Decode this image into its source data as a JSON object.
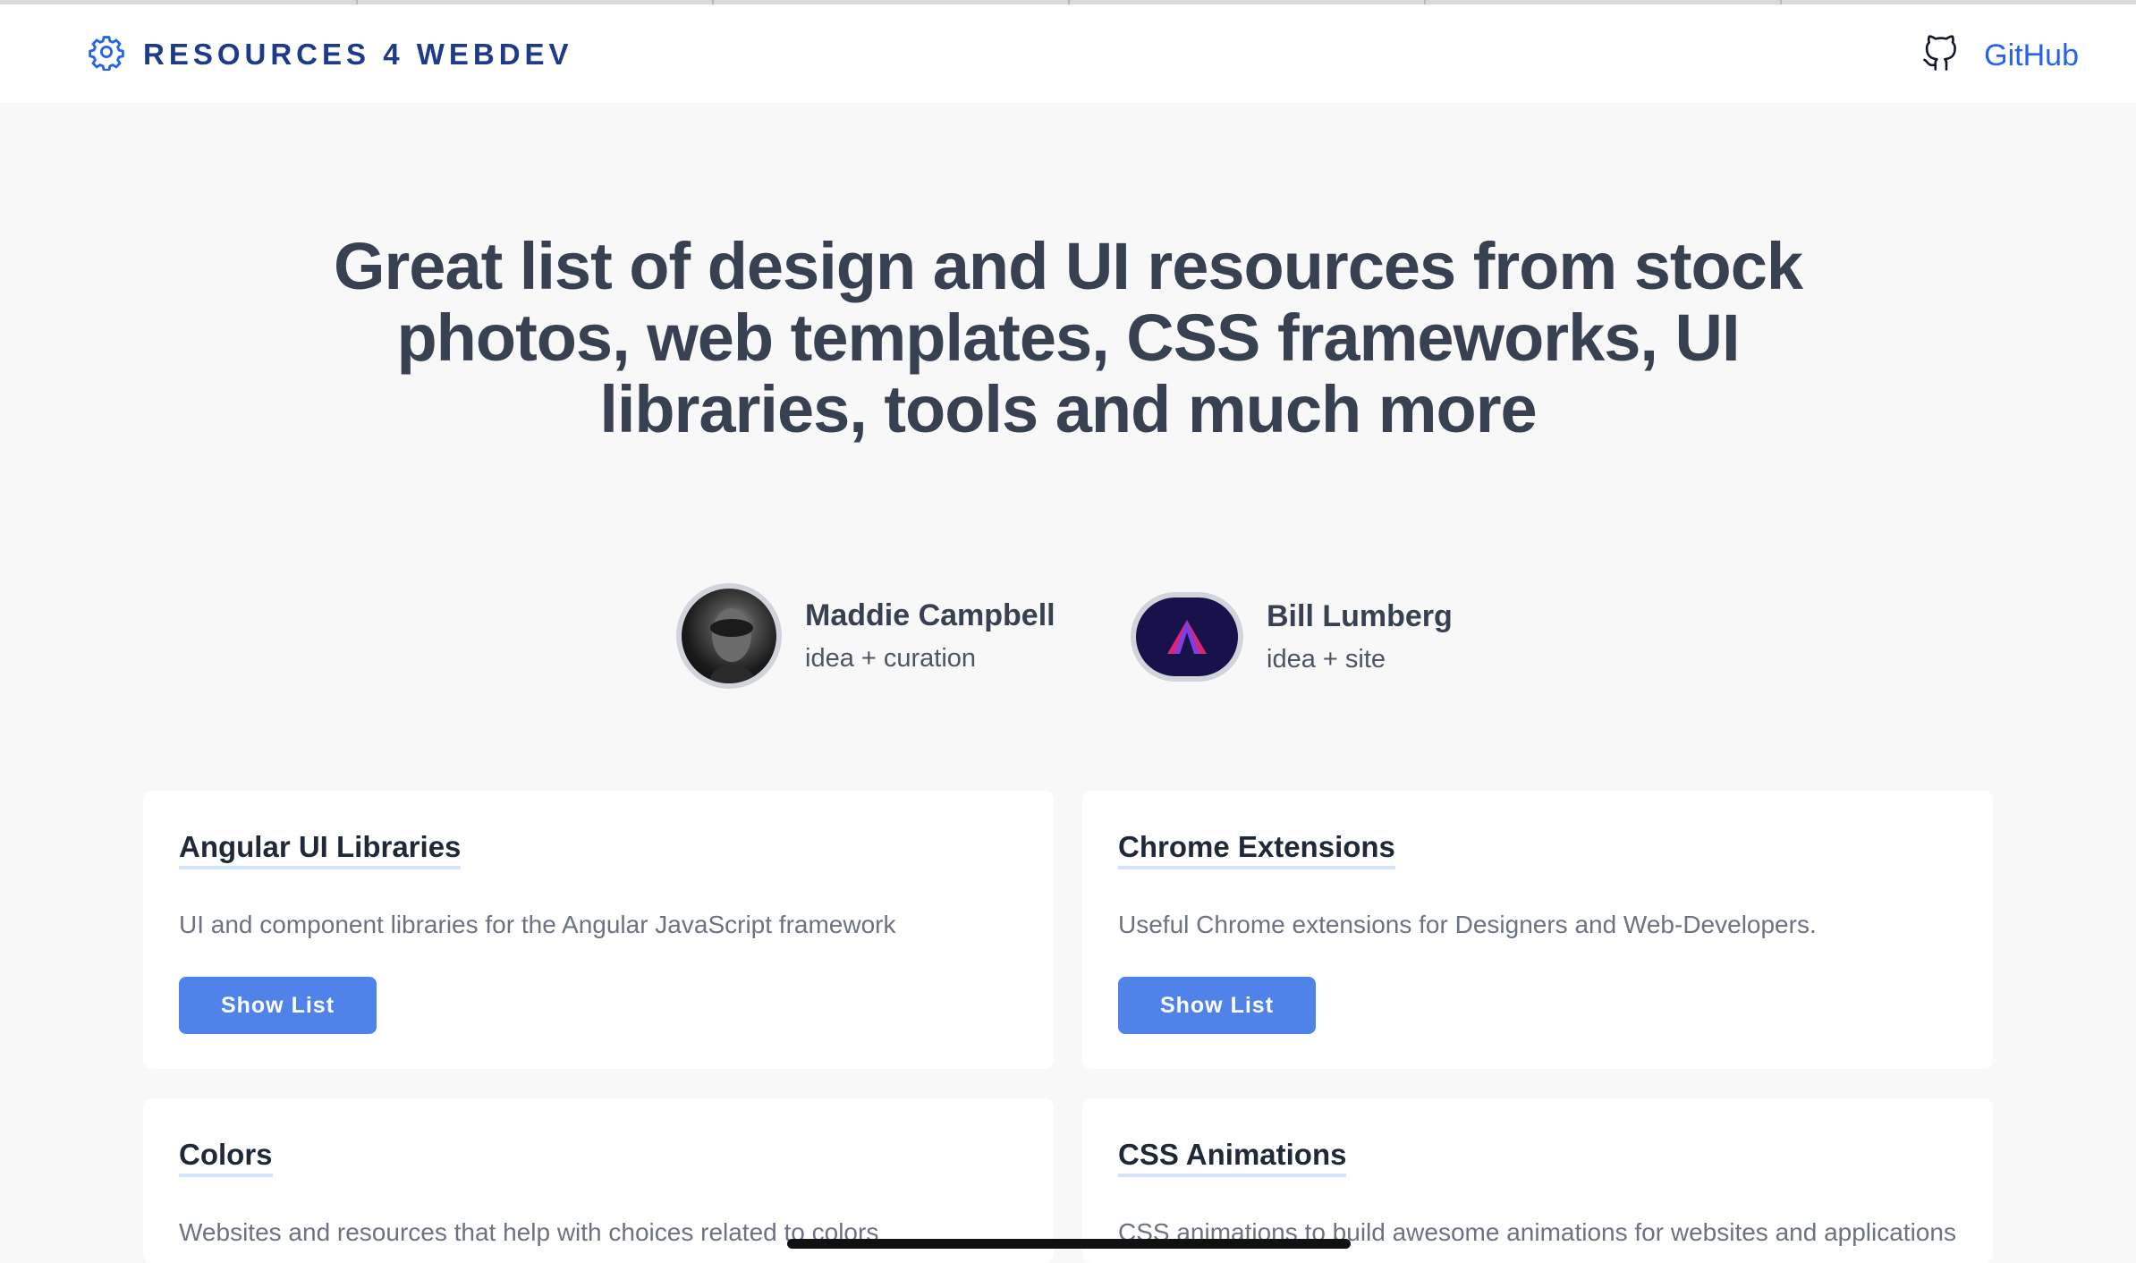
{
  "header": {
    "brand": "RESOURCES 4 WEBDEV",
    "github_label": "GitHub",
    "accent_color": "#1e3a8a",
    "link_color": "#2563eb",
    "brand_icon": "gear-icon",
    "github_icon": "github-icon"
  },
  "hero": {
    "title": "Great list of design and UI resources from stock photos, web templates, CSS frameworks, UI libraries, tools and much more"
  },
  "authors": [
    {
      "name": "Maddie Campbell",
      "role": "idea + curation",
      "avatar": "photo-avatar"
    },
    {
      "name": "Bill Lumberg",
      "role": "idea + site",
      "avatar": "logo-avatar"
    }
  ],
  "cards": [
    {
      "title": "Angular UI Libraries",
      "description": "UI and component libraries for the Angular JavaScript framework",
      "button": "Show List"
    },
    {
      "title": "Chrome Extensions",
      "description": "Useful Chrome extensions for Designers and Web-Developers.",
      "button": "Show List"
    },
    {
      "title": "Colors",
      "description": "Websites and resources that help with choices related to colors"
    },
    {
      "title": "CSS Animations",
      "description": "CSS animations to build awesome animations for websites and applications"
    }
  ],
  "colors": {
    "button": "#4f83ea",
    "page_background": "#f8f8f8"
  }
}
